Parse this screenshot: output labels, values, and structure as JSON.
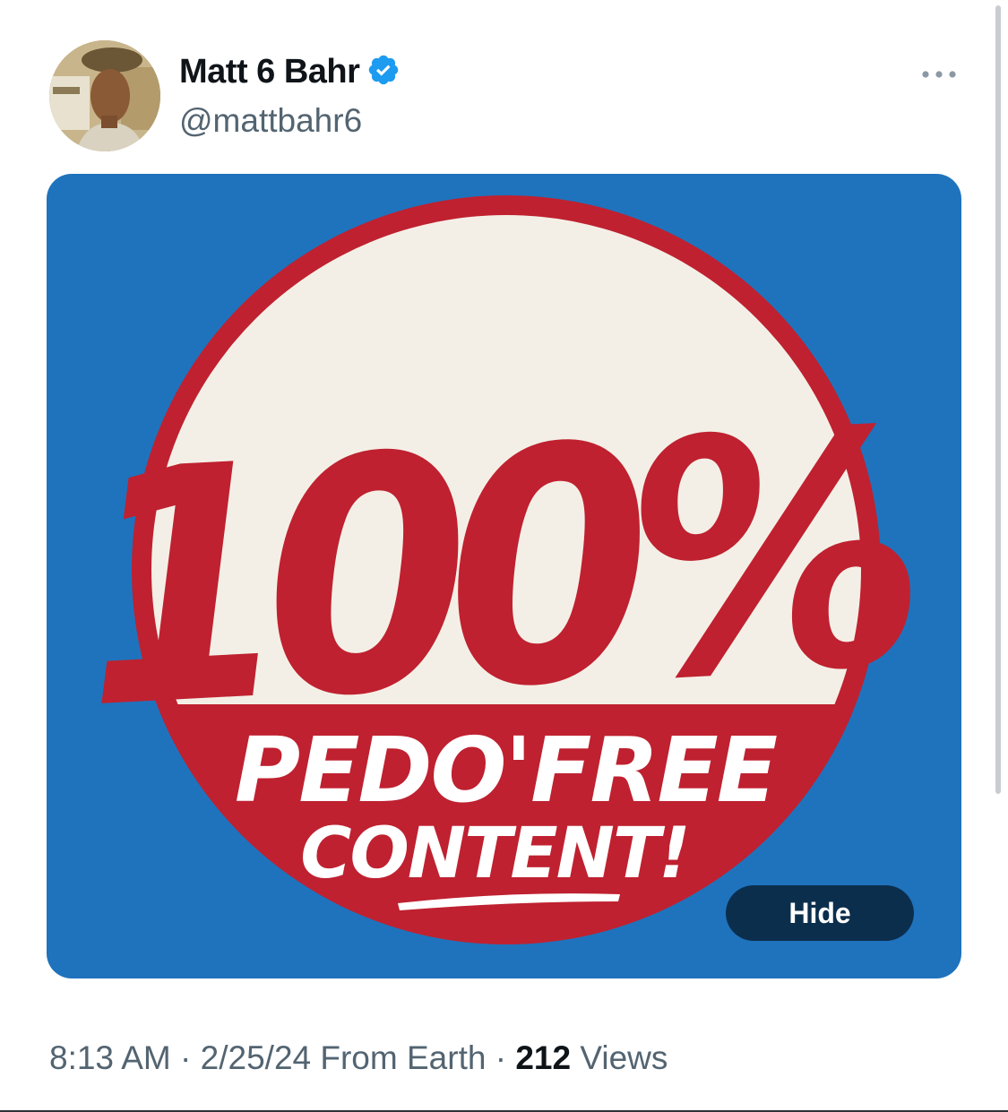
{
  "tweet": {
    "author": {
      "display_name": "Matt 6 Bahr",
      "handle": "@mattbahr6",
      "verified": true,
      "verified_badge_color": "#1d9bf0"
    },
    "media": {
      "background_color": "#1f73bd",
      "badge": {
        "headline": "100%",
        "line1": "PEDO'FREE",
        "line2": "CONTENT!",
        "red": "#bf2130",
        "cream": "#f4efe6"
      },
      "hide_label": "Hide"
    },
    "meta": {
      "time": "8:13 AM",
      "sep1": " · ",
      "date": "2/25/24",
      "source": " From Earth",
      "sep2": " · ",
      "views_count": "212",
      "views_label": " Views"
    }
  },
  "icons": {
    "more": "more-horizontal-icon",
    "verified": "verified-badge-icon"
  }
}
